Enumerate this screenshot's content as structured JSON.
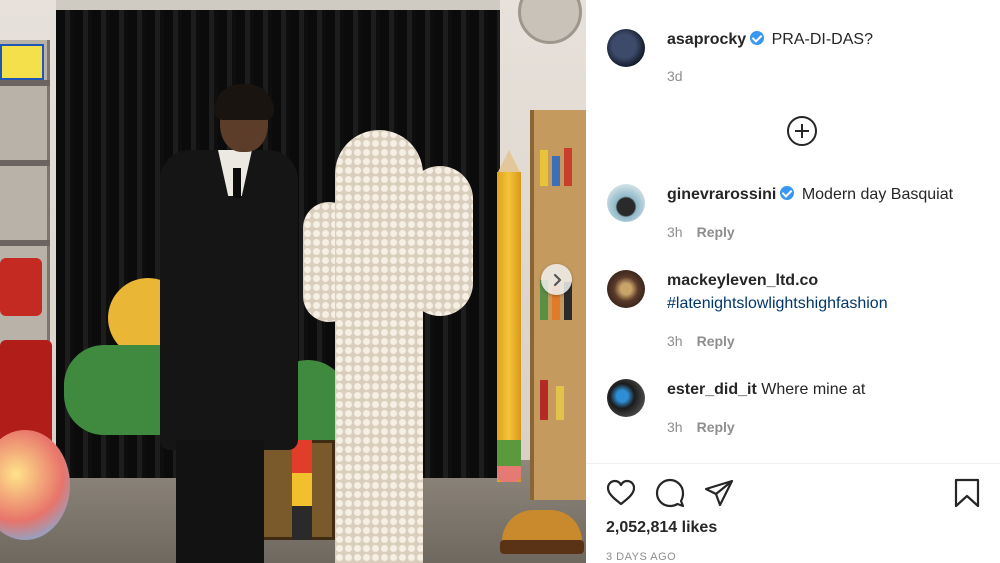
{
  "post": {
    "author": "asaprocky",
    "author_verified": true,
    "caption": "PRA-DI-DAS?",
    "time": "3d"
  },
  "comments": [
    {
      "username": "ginevrarossini",
      "verified": true,
      "text": "Modern day Basquiat",
      "time": "3h",
      "reply": "Reply"
    },
    {
      "username": "mackeyleven_ltd.co",
      "verified": false,
      "text": "#latenightslowlightshighfashion",
      "time": "3h",
      "reply": "Reply"
    },
    {
      "username": "ester_did_it",
      "verified": false,
      "text": "Where mine at",
      "time": "3h",
      "reply": "Reply"
    }
  ],
  "icons": {
    "load_more": "plus-circle-icon",
    "like": "heart-icon",
    "comment": "comment-icon",
    "share": "paper-plane-icon",
    "save": "bookmark-icon",
    "next": "chevron-right-icon"
  },
  "likes": "2,052,814 likes",
  "date": "3 DAYS AGO",
  "colors": {
    "verified": "#3897f0",
    "hashtag": "#00376b",
    "muted": "#8e8e8e",
    "text": "#262626"
  }
}
